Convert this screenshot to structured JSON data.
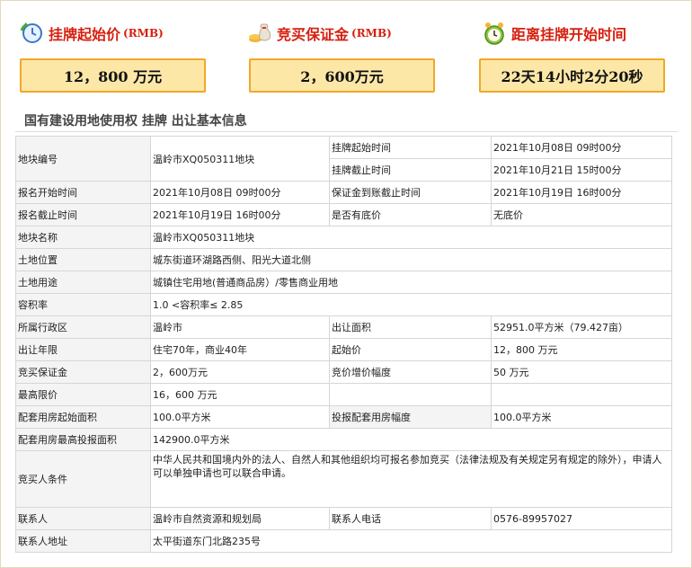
{
  "kpis": {
    "start_price": {
      "title": "挂牌起始价",
      "unit_tag": "(RMB)",
      "value": "12，800 万元"
    },
    "deposit": {
      "title": "竞买保证金",
      "unit_tag": "(RMB)",
      "value": "2，600万元"
    },
    "countdown": {
      "title": "距离挂牌开始时间",
      "value": "22天14小时2分20秒"
    }
  },
  "section_title": "国有建设用地使用权 挂牌 出让基本信息",
  "rows": {
    "r1": {
      "label": "地块编号",
      "value": "温岭市XQ050311地块",
      "label2": "挂牌起始时间",
      "value2": "2021年10月08日 09时00分"
    },
    "r1b": {
      "label2": "挂牌截止时间",
      "value2": "2021年10月21日 15时00分"
    },
    "r2": {
      "label": "报名开始时间",
      "value": "2021年10月08日 09时00分",
      "label2": "保证金到账截止时间",
      "value2": "2021年10月19日 16时00分"
    },
    "r3": {
      "label": "报名截止时间",
      "value": "2021年10月19日 16时00分",
      "label2": "是否有底价",
      "value2": "无底价"
    },
    "r4": {
      "label": "地块名称",
      "value": "温岭市XQ050311地块"
    },
    "r5": {
      "label": "土地位置",
      "value": "城东街道环湖路西侧、阳光大道北侧"
    },
    "r6": {
      "label": "土地用途",
      "value": "城镇住宅用地(普通商品房）/零售商业用地"
    },
    "r7": {
      "label": "容积率",
      "value": "1.0 <容积率≤ 2.85"
    },
    "r8": {
      "label": "所属行政区",
      "value": "温岭市",
      "label2": "出让面积",
      "value2": "52951.0平方米（79.427亩）"
    },
    "r9": {
      "label": "出让年限",
      "value": "住宅70年，商业40年",
      "label2": "起始价",
      "value2": "12，800 万元"
    },
    "r10": {
      "label": "竞买保证金",
      "value": "2，600万元",
      "label2": "竞价增价幅度",
      "value2": "50 万元"
    },
    "r11": {
      "label": "最高限价",
      "value": "16，600 万元",
      "label2": "",
      "value2": ""
    },
    "r12": {
      "label": "配套用房起始面积",
      "value": "100.0平方米",
      "label2": "投报配套用房幅度",
      "value2": "100.0平方米"
    },
    "r13": {
      "label": "配套用房最高投报面积",
      "value": "142900.0平方米"
    },
    "r14": {
      "label": "竞买人条件",
      "value": "中华人民共和国境内外的法人、自然人和其他组织均可报名参加竞买（法律法规及有关规定另有规定的除外），申请人可以单独申请也可以联合申请。"
    },
    "r15": {
      "label": "联系人",
      "value": "温岭市自然资源和规划局",
      "label2": "联系人电话",
      "value2": "0576-89957027"
    },
    "r16": {
      "label": "联系人地址",
      "value": "太平街道东门北路235号"
    }
  }
}
